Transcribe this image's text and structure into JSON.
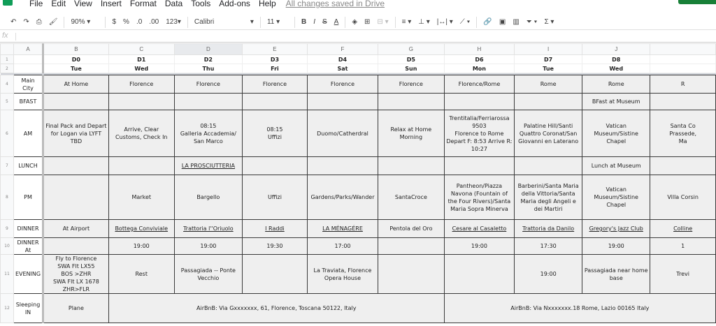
{
  "app": {
    "menus": [
      "File",
      "Edit",
      "View",
      "Insert",
      "Format",
      "Data",
      "Tools",
      "Add-ons",
      "Help"
    ],
    "save_status": "All changes saved in Drive",
    "accent": "#188038"
  },
  "toolbar": {
    "zoom": "90%",
    "currency": "$",
    "percent": "%",
    "dec_less": ".0",
    "dec_more": ".00",
    "format_more": "123",
    "font": "Calibri",
    "font_size": "11",
    "bold": "B",
    "italic": "I",
    "strike": "S",
    "text_color": "A",
    "sigma": "Σ",
    "fx": "fx"
  },
  "columns": [
    "A",
    "B",
    "C",
    "D",
    "E",
    "F",
    "G",
    "H",
    "I",
    "J",
    ""
  ],
  "day_codes": [
    "",
    "D0",
    "D1",
    "D2",
    "D3",
    "D4",
    "D5",
    "D6",
    "D7",
    "D8",
    ""
  ],
  "day_names": [
    "",
    "Tue",
    "Wed",
    "Thu",
    "Fri",
    "Sat",
    "Sun",
    "Mon",
    "Tue",
    "Wed",
    ""
  ],
  "rows": [
    {
      "num": "4",
      "label": "Main City",
      "h": 26,
      "cells": [
        "At Home",
        "Florence",
        "Florence",
        "Florence",
        "Florence",
        "Florence",
        "Florence/Rome",
        "Rome",
        "Rome",
        "R"
      ]
    },
    {
      "num": "5",
      "label": "BFAST",
      "h": 24,
      "cells": [
        "",
        "",
        "",
        "",
        "",
        "",
        "",
        "",
        "BFast at Museum",
        ""
      ]
    },
    {
      "num": "6",
      "label": "AM",
      "h": 67,
      "cells": [
        "Final Pack and Depart for Logan via LYFT TBD",
        "Arrive, Clear Customs, Check In",
        "08:15\nGalleria Accademia/ San Marco",
        "08:15\nUffizi",
        "Duomo/Catherdral",
        "Relax at Home Morning",
        "Trentitalia/Ferriarossa 9503\nFlorence to Rome\nDepart F: 8:53 Arrive R: 10:27",
        "Palatine Hill/Santi Quattro Coronat/San Giovanni en Laterano",
        "Vatican Museum/Sistine Chapel",
        "Santa Co\nPrassede,\nMa"
      ]
    },
    {
      "num": "7",
      "label": "LUNCH",
      "h": 26,
      "cells": [
        "",
        "",
        {
          "t": "LA PROSCIUTTERIA",
          "link": true
        },
        "",
        "",
        "",
        "",
        "",
        "Lunch at Museum",
        ""
      ]
    },
    {
      "num": "8",
      "label": "PM",
      "h": 64,
      "cells": [
        "",
        "Market",
        "Bargello",
        "Uffizi",
        "Gardens/Parks/Wander",
        "SantaCroce",
        "Pantheon/Piazza Navona (Fountain of the Four Rivers)/Santa Maria Sopra Minerva",
        "Barberini/Santa Maria della Vittoria/Santa Maria degli Angeli e dei Martiri",
        "Vatican Museum/Sistine Chapel",
        "Villa Corsin"
      ]
    },
    {
      "num": "9",
      "label": "DINNER",
      "h": 26,
      "cells": [
        "At Airport",
        {
          "t": "Bottega Conviviale",
          "link": true
        },
        {
          "t": "Trattoria l''Oriuolo",
          "link": true
        },
        {
          "t": "I Raddi",
          "link": true
        },
        {
          "t": "LA MÉNAGÉRE",
          "link": true
        },
        "Pentola del Oro",
        {
          "t": "Cesare al Casaletto",
          "link": true
        },
        {
          "t": "Trattoria da Danilo",
          "link": true
        },
        {
          "t": "Gregory's Jazz Club",
          "link": true
        },
        {
          "t": "Colline",
          "link": true
        }
      ]
    },
    {
      "num": "10",
      "label": "DINNER At",
      "h": 24,
      "cells": [
        "",
        "19:00",
        "19:00",
        "19:30",
        "17:00",
        "",
        "19:00",
        "17:30",
        "19:00",
        "1"
      ]
    },
    {
      "num": "11",
      "label": "EVENING",
      "h": 56,
      "cells": [
        "Fly to Florence\nSWA Flt  LX55\nBOS >ZHR\nSWA Flt LX 1678\nZHR>FLR",
        "Rest",
        "Passagiada -- Ponte Vecchio",
        "",
        "La Traviata, Florence Opera House",
        "",
        "",
        "19:00",
        "Passagiada near home base",
        "Trevi"
      ]
    },
    {
      "num": "12",
      "label": "Sleeping IN",
      "h": 42,
      "cells": [
        "Plane",
        {
          "t": "AirBnB:  Via Gxxxxxxx, 61, Florence, Toscana 50122, Italy",
          "span": 5
        },
        {
          "t": "AirBnB:  Via Nxxxxxxx.18   Rome, Lazio 00165 Italy",
          "span": 4
        }
      ]
    }
  ]
}
